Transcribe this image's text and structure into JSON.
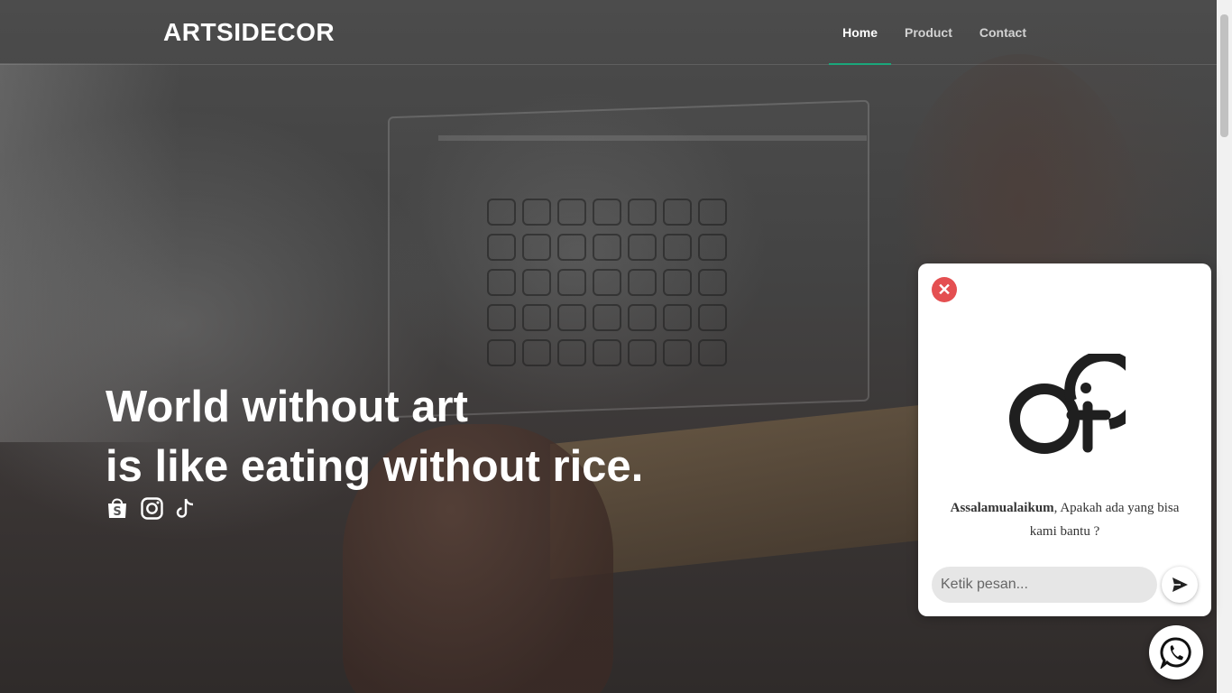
{
  "brand": "ARTSIDECOR",
  "nav": [
    {
      "label": "Home",
      "active": true
    },
    {
      "label": "Product",
      "active": false
    },
    {
      "label": "Contact",
      "active": false
    }
  ],
  "hero": {
    "line1": "World without art",
    "line2": "is like eating without rice."
  },
  "socials": [
    {
      "icon": "shopee-icon"
    },
    {
      "icon": "instagram-icon"
    },
    {
      "icon": "tiktok-icon"
    }
  ],
  "chat": {
    "greeting_bold": "Assalamualaikum",
    "greeting_rest": ", Apakah ada yang bisa kami bantu ?",
    "input_placeholder": "Ketik pesan...",
    "close_icon": "close-icon",
    "send_icon": "send-icon"
  },
  "colors": {
    "accent": "#1aa77b",
    "close": "#e44f51"
  }
}
